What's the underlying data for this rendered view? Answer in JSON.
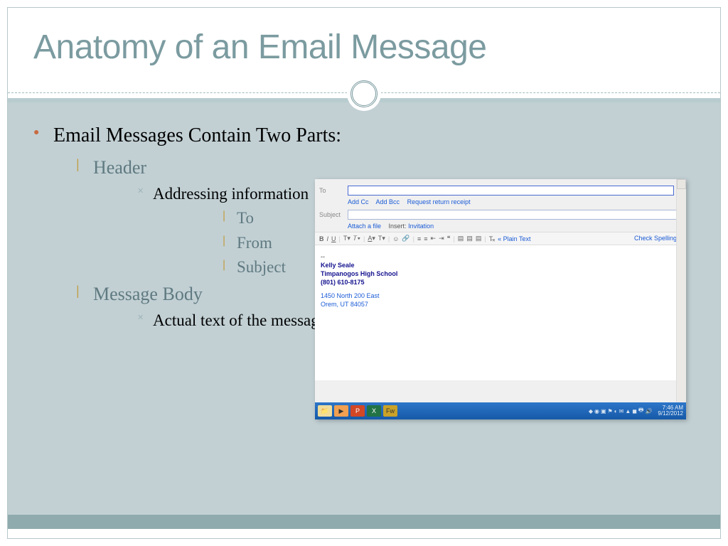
{
  "slide": {
    "title": "Anatomy of an Email Message",
    "main_point": "Email Messages Contain Two Parts:",
    "header_label": "Header",
    "addressing_label": "Addressing information",
    "to_label": "To",
    "from_label": "From",
    "subject_label": "Subject",
    "body_label": "Message Body",
    "body_desc": "Actual text of the message"
  },
  "email": {
    "to_label": "To",
    "subject_label": "Subject",
    "links": {
      "add_cc": "Add Cc",
      "add_bcc": "Add Bcc",
      "request_receipt": "Request return receipt",
      "attach": "Attach a file",
      "insert_label": "Insert:",
      "invitation": "Invitation"
    },
    "toolbar": {
      "plain_text": "« Plain Text",
      "check_spelling": "Check Spelling ▾"
    },
    "signature": {
      "name": "Kelly Seale",
      "school": "Timpanogos High School",
      "phone": "(801) 610-8175",
      "addr1": "1450 North 200 East",
      "addr2": "Orem, UT 84057"
    },
    "taskbar": {
      "time": "7:46 AM",
      "date": "9/12/2012"
    }
  }
}
